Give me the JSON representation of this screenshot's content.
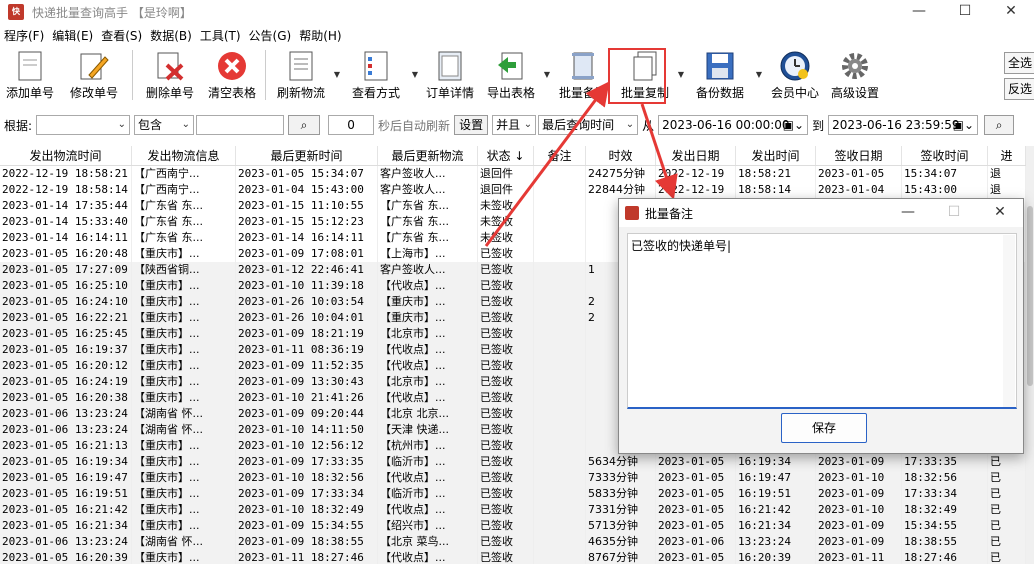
{
  "window": {
    "title": "快递批量查询高手 【是玲啊】",
    "minimize": "—",
    "maximize": "☐",
    "close": "✕"
  },
  "menu": [
    "程序(F)",
    "编辑(E)",
    "查看(S)",
    "数据(B)",
    "工具(T)",
    "公告(G)",
    "帮助(H)"
  ],
  "toolbar": {
    "add": "添加单号",
    "edit": "修改单号",
    "delete": "删除单号",
    "clear": "清空表格",
    "refresh": "刷新物流",
    "view_mode": "查看方式",
    "order_detail": "订单详情",
    "export": "导出表格",
    "batch_note": "批量备注",
    "batch_copy": "批量复制",
    "backup": "备份数据",
    "member": "会员中心",
    "advanced": "高级设置",
    "select_all": "全选",
    "invert": "反选"
  },
  "filter": {
    "by_label": "根据:",
    "field_value": "",
    "match_value": "包含",
    "keyword": "",
    "refresh_seconds": "0",
    "refresh_label": "秒后自动刷新",
    "set_button": "设置",
    "logic_value": "并且",
    "time_field": "最后查询时间",
    "from_label": "从",
    "from_value": "2023-06-16 00:00:00",
    "to_label": "到",
    "to_value": "2023-06-16 23:59:59"
  },
  "columns": [
    "发出物流时间",
    "发出物流信息",
    "最后更新时间",
    "最后更新物流",
    "状态 ↓",
    "备注",
    "时效",
    "发出日期",
    "发出时间",
    "签收日期",
    "签收时间",
    "进"
  ],
  "rows": [
    [
      "2022-12-19 18:58:21",
      "【广西南宁...",
      "2023-01-05 15:34:07",
      "客户签收人...",
      "退回件",
      "",
      "24275分钟",
      "2022-12-19",
      "18:58:21",
      "2023-01-05",
      "15:34:07",
      "退"
    ],
    [
      "2022-12-19 18:58:14",
      "【广西南宁...",
      "2023-01-04 15:43:00",
      "客户签收人...",
      "退回件",
      "",
      "22844分钟",
      "2022-12-19",
      "18:58:14",
      "2023-01-04",
      "15:43:00",
      "退"
    ],
    [
      "2023-01-14 17:35:44",
      "【广东省 东...",
      "2023-01-15 11:10:55",
      "【广东省 东...",
      "未签收",
      "",
      "",
      "",
      "",
      "",
      "",
      ""
    ],
    [
      "2023-01-14 15:33:40",
      "【广东省 东...",
      "2023-01-15 15:12:23",
      "【广东省 东...",
      "未签收",
      "",
      "",
      "",
      "",
      "",
      "",
      ""
    ],
    [
      "2023-01-14 16:14:11",
      "【广东省 东...",
      "2023-01-14 16:14:11",
      "【广东省 东...",
      "未签收",
      "",
      "",
      "",
      "",
      "",
      "",
      ""
    ],
    [
      "2023-01-05 16:20:48",
      "【重庆市】...",
      "2023-01-09 17:08:01",
      "【上海市】...",
      "已签收",
      "",
      "",
      "",
      "",
      "",
      "",
      ""
    ],
    [
      "2023-01-05 17:27:09",
      "【陕西省铜...",
      "2023-01-12 22:46:41",
      "客户签收人...",
      "已签收",
      "",
      "1",
      "",
      "",
      "",
      "",
      ""
    ],
    [
      "2023-01-05 16:25:10",
      "【重庆市】...",
      "2023-01-10 11:39:18",
      "【代收点】...",
      "已签收",
      "",
      "",
      "",
      "",
      "",
      "",
      ""
    ],
    [
      "2023-01-05 16:24:10",
      "【重庆市】...",
      "2023-01-26 10:03:54",
      "【重庆市】...",
      "已签收",
      "",
      "2",
      "",
      "",
      "",
      "",
      ""
    ],
    [
      "2023-01-05 16:22:21",
      "【重庆市】...",
      "2023-01-26 10:04:01",
      "【重庆市】...",
      "已签收",
      "",
      "2",
      "",
      "",
      "",
      "",
      ""
    ],
    [
      "2023-01-05 16:25:45",
      "【重庆市】...",
      "2023-01-09 18:21:19",
      "【北京市】...",
      "已签收",
      "",
      "",
      "",
      "",
      "",
      "",
      ""
    ],
    [
      "2023-01-05 16:19:37",
      "【重庆市】...",
      "2023-01-11 08:36:19",
      "【代收点】...",
      "已签收",
      "",
      "",
      "",
      "",
      "",
      "",
      ""
    ],
    [
      "2023-01-05 16:20:12",
      "【重庆市】...",
      "2023-01-09 11:52:35",
      "【代收点】...",
      "已签收",
      "",
      "",
      "",
      "",
      "",
      "",
      ""
    ],
    [
      "2023-01-05 16:24:19",
      "【重庆市】...",
      "2023-01-09 13:30:43",
      "【北京市】...",
      "已签收",
      "",
      "",
      "",
      "",
      "",
      "",
      ""
    ],
    [
      "2023-01-05 16:20:38",
      "【重庆市】...",
      "2023-01-10 21:41:26",
      "【代收点】...",
      "已签收",
      "",
      "",
      "",
      "",
      "",
      "",
      ""
    ],
    [
      "2023-01-06 13:23:24",
      "【湖南省 怀...",
      "2023-01-09 09:20:44",
      "【北京 北京...",
      "已签收",
      "",
      "",
      "",
      "",
      "",
      "",
      ""
    ],
    [
      "2023-01-06 13:23:24",
      "【湖南省 怀...",
      "2023-01-10 14:11:50",
      "【天津 快递...",
      "已签收",
      "",
      "",
      "",
      "",
      "",
      "",
      ""
    ],
    [
      "2023-01-05 16:21:13",
      "【重庆市】...",
      "2023-01-10 12:56:12",
      "【杭州市】...",
      "已签收",
      "",
      "",
      "",
      "",
      "",
      "",
      ""
    ],
    [
      "2023-01-05 16:19:34",
      "【重庆市】...",
      "2023-01-09 17:33:35",
      "【临沂市】...",
      "已签收",
      "",
      "5634分钟",
      "2023-01-05",
      "16:19:34",
      "2023-01-09",
      "17:33:35",
      "已"
    ],
    [
      "2023-01-05 16:19:47",
      "【重庆市】...",
      "2023-01-10 18:32:56",
      "【代收点】...",
      "已签收",
      "",
      "7333分钟",
      "2023-01-05",
      "16:19:47",
      "2023-01-10",
      "18:32:56",
      "已"
    ],
    [
      "2023-01-05 16:19:51",
      "【重庆市】...",
      "2023-01-09 17:33:34",
      "【临沂市】...",
      "已签收",
      "",
      "5833分钟",
      "2023-01-05",
      "16:19:51",
      "2023-01-09",
      "17:33:34",
      "已"
    ],
    [
      "2023-01-05 16:21:42",
      "【重庆市】...",
      "2023-01-10 18:32:49",
      "【代收点】...",
      "已签收",
      "",
      "7331分钟",
      "2023-01-05",
      "16:21:42",
      "2023-01-10",
      "18:32:49",
      "已"
    ],
    [
      "2023-01-05 16:21:34",
      "【重庆市】...",
      "2023-01-09 15:34:55",
      "【绍兴市】...",
      "已签收",
      "",
      "5713分钟",
      "2023-01-05",
      "16:21:34",
      "2023-01-09",
      "15:34:55",
      "已"
    ],
    [
      "2023-01-06 13:23:24",
      "【湖南省 怀...",
      "2023-01-09 18:38:55",
      "【北京 菜鸟...",
      "已签收",
      "",
      "4635分钟",
      "2023-01-06",
      "13:23:24",
      "2023-01-09",
      "18:38:55",
      "已"
    ],
    [
      "2023-01-05 16:20:39",
      "【重庆市】...",
      "2023-01-11 18:27:46",
      "【代收点】...",
      "已签收",
      "",
      "8767分钟",
      "2023-01-05",
      "16:20:39",
      "2023-01-11",
      "18:27:46",
      "已"
    ]
  ],
  "dialog": {
    "title": "批量备注",
    "text": "已签收的快递单号|",
    "save": "保存",
    "minimize": "—",
    "maximize": "☐",
    "close": "✕"
  },
  "colors": {
    "highlight_red": "#e53935",
    "accent_blue": "#2a62c6"
  }
}
